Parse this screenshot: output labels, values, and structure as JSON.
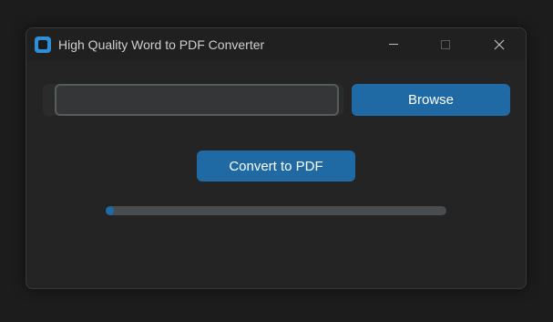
{
  "window": {
    "title": "High Quality Word to PDF Converter",
    "icon": "app-icon",
    "controls": [
      "minimize-icon",
      "maximize-icon",
      "close-icon"
    ]
  },
  "file_input": {
    "value": "",
    "placeholder": ""
  },
  "browse_button": {
    "label": "Browse"
  },
  "convert_button": {
    "label": "Convert to PDF"
  },
  "progress": {
    "fraction": 0.025
  },
  "colors": {
    "window_bg": "#242424",
    "titlebar_bg": "#202020",
    "accent": "#1f6aa5",
    "input_bg": "#343638",
    "input_border": "#565b5e",
    "progress_track": "#4a4d50",
    "app_icon": "#2e8fd8"
  }
}
